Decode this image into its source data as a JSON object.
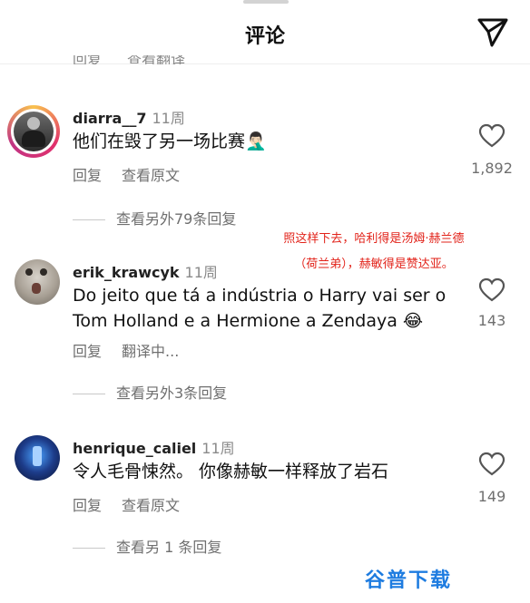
{
  "header": {
    "title": "评论",
    "send_icon": "paper-plane-icon"
  },
  "partial_row": {
    "left": "回复",
    "right": "查看翻译"
  },
  "comments": [
    {
      "username": "diarra__7",
      "time": "11周",
      "text_main": "他们在毁了另一场比赛",
      "text_emoji": "🤦🏻‍♂️",
      "actions": [
        "回复",
        "查看原文"
      ],
      "likes": "1,892",
      "replies": "查看另外79条回复"
    },
    {
      "username": "erik_krawcyk",
      "time": "11周",
      "text_line1": "Do jeito que tá a indústria o Harry vai ser o",
      "text_line2": "Tom Holland e a Hermione a Zendaya",
      "text_emoji": "😂",
      "actions": [
        "回复",
        "翻译中..."
      ],
      "likes": "143",
      "replies": "查看另外3条回复"
    },
    {
      "username": "henrique_caliel",
      "time": "11周",
      "text_main": "令人毛骨悚然。 你像赫敏一样释放了岩石",
      "actions": [
        "回复",
        "查看原文"
      ],
      "likes": "149",
      "replies": "查看另 1 条回复"
    }
  ],
  "annotation": {
    "line1": "照这样下去，哈利得是汤姆·赫兰德",
    "line2": "（荷兰弟），赫敏得是赞达亚。",
    "color": "#e2231a"
  },
  "watermark": "谷普下载"
}
